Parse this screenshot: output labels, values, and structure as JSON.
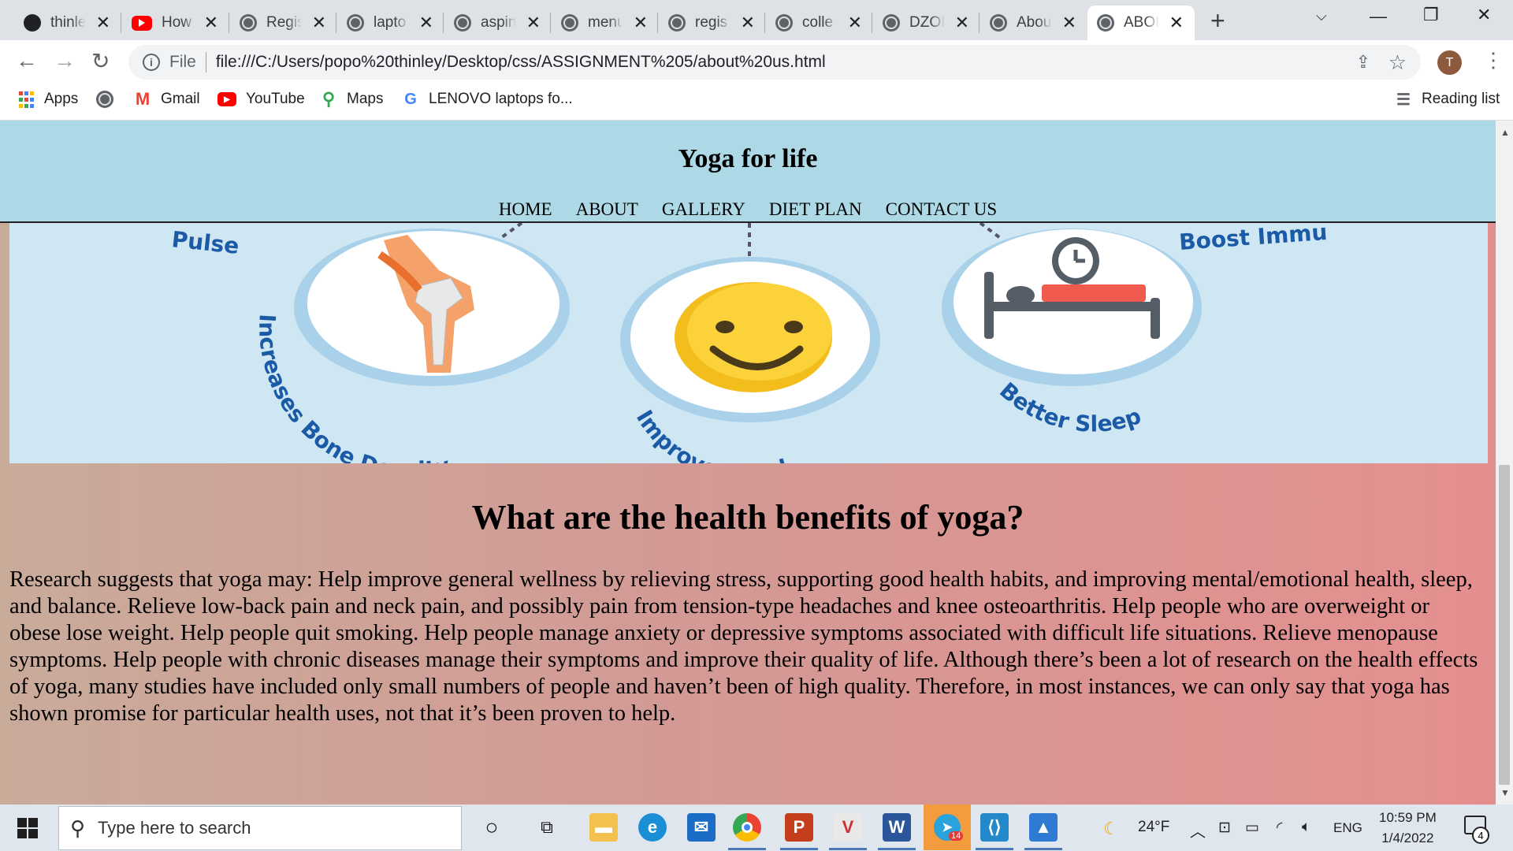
{
  "browser": {
    "tabs": [
      {
        "title": "thinle",
        "icon": "github-icon"
      },
      {
        "title": "How",
        "icon": "youtube-icon"
      },
      {
        "title": "Regis",
        "icon": "globe-icon"
      },
      {
        "title": "lapto",
        "icon": "globe-icon"
      },
      {
        "title": "aspin",
        "icon": "globe-icon"
      },
      {
        "title": "menu",
        "icon": "globe-icon"
      },
      {
        "title": "regis",
        "icon": "globe-icon"
      },
      {
        "title": "colle",
        "icon": "globe-icon"
      },
      {
        "title": "DZOI",
        "icon": "globe-icon"
      },
      {
        "title": "Abou",
        "icon": "globe-icon"
      },
      {
        "title": "ABOI",
        "icon": "globe-icon",
        "active": true
      }
    ],
    "address": {
      "scheme": "File",
      "url": "file:///C:/Users/popo%20thinley/Desktop/css/ASSIGNMENT%205/about%20us.html"
    },
    "profile_initial": "T",
    "bookmarks": [
      {
        "label": "Apps",
        "icon": "apps-grid-icon"
      },
      {
        "label": "",
        "icon": "globe-icon"
      },
      {
        "label": "Gmail",
        "icon": "gmail-icon"
      },
      {
        "label": "YouTube",
        "icon": "youtube-icon"
      },
      {
        "label": "Maps",
        "icon": "maps-pin-icon"
      },
      {
        "label": "LENOVO laptops fo...",
        "icon": "google-icon"
      }
    ],
    "reading_list": "Reading list"
  },
  "page": {
    "site_title": "Yoga for life",
    "nav": [
      "HOME",
      "ABOUT",
      "GALLERY",
      "DIET PLAN",
      "CONTACT US"
    ],
    "hero": {
      "labels": [
        "Pulse",
        "Increases Bone Density",
        "Improve Mood",
        "Better Sleep",
        "Boost Immu"
      ]
    },
    "heading": "What are the health benefits of yoga?",
    "paragraph": "Research suggests that yoga may: Help improve general wellness by relieving stress, supporting good health habits, and improving mental/emotional health, sleep, and balance. Relieve low-back pain and neck pain, and possibly pain from tension-type headaches and knee osteoarthritis. Help people who are overweight or obese lose weight. Help people quit smoking. Help people manage anxiety or depressive symptoms associated with difficult life situations. Relieve menopause symptoms. Help people with chronic diseases manage their symptoms and improve their quality of life. Although there’s been a lot of research on the health effects of yoga, many studies have included only small numbers of people and haven’t been of high quality. Therefore, in most instances, we can only say that yoga has shown promise for particular health uses, not that it’s been proven to help.",
    "colors": {
      "header_bg": "#add8e6",
      "hero_bg": "#cfe6f3",
      "gradient_start": "#c9ab9a",
      "gradient_end": "#e48f8f"
    }
  },
  "taskbar": {
    "search_placeholder": "Type here to search",
    "weather": "24°F",
    "language": "ENG",
    "time": "10:59 PM",
    "date": "1/4/2022",
    "notification_count": "4",
    "telegram_badge": "14"
  }
}
